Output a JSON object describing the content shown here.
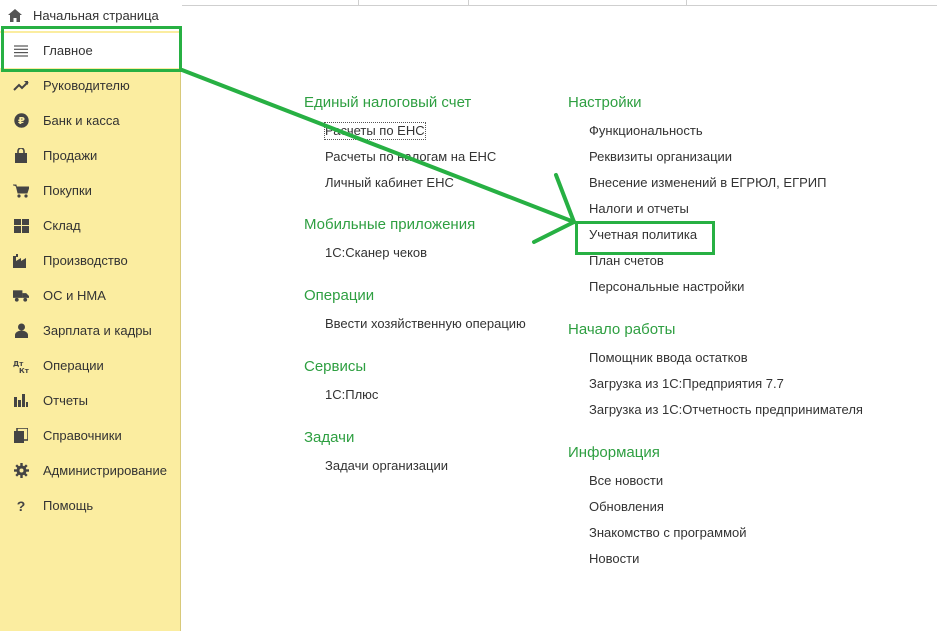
{
  "sidebar": {
    "home_label": "Начальная страница",
    "items": [
      {
        "label": "Главное",
        "icon": "menu-lines-icon",
        "active": true
      },
      {
        "label": "Руководителю",
        "icon": "trend-up-icon"
      },
      {
        "label": "Банк и касса",
        "icon": "ruble-coin-icon"
      },
      {
        "label": "Продажи",
        "icon": "shopping-bag-icon"
      },
      {
        "label": "Покупки",
        "icon": "shopping-cart-icon"
      },
      {
        "label": "Склад",
        "icon": "warehouse-grid-icon"
      },
      {
        "label": "Производство",
        "icon": "factory-icon"
      },
      {
        "label": "ОС и НМА",
        "icon": "truck-icon"
      },
      {
        "label": "Зарплата и кадры",
        "icon": "person-icon"
      },
      {
        "label": "Операции",
        "icon": "debit-credit-icon"
      },
      {
        "label": "Отчеты",
        "icon": "bar-chart-icon"
      },
      {
        "label": "Справочники",
        "icon": "books-icon"
      },
      {
        "label": "Администрирование",
        "icon": "gear-icon"
      },
      {
        "label": "Помощь",
        "icon": "question-icon"
      }
    ]
  },
  "left_sections": [
    {
      "title": "Единый налоговый счет",
      "links": [
        "Расчеты по ЕНС",
        "Расчеты по налогам на ЕНС",
        "Личный кабинет ЕНС"
      ]
    },
    {
      "title": "Мобильные приложения",
      "links": [
        "1С:Сканер чеков"
      ]
    },
    {
      "title": "Операции",
      "links": [
        "Ввести хозяйственную операцию"
      ]
    },
    {
      "title": "Сервисы",
      "links": [
        "1С:Плюс"
      ]
    },
    {
      "title": "Задачи",
      "links": [
        "Задачи организации"
      ]
    }
  ],
  "right_sections": [
    {
      "title": "Настройки",
      "links": [
        "Функциональность",
        "Реквизиты организации",
        "Внесение изменений в ЕГРЮЛ, ЕГРИП",
        "Налоги и отчеты",
        "Учетная политика",
        "План счетов",
        "Персональные настройки"
      ]
    },
    {
      "title": "Начало работы",
      "links": [
        "Помощник ввода остатков",
        "Загрузка из 1С:Предприятия 7.7",
        "Загрузка из 1С:Отчетность предпринимателя"
      ]
    },
    {
      "title": "Информация",
      "links": [
        "Все новости",
        "Обновления",
        "Знакомство с программой",
        "Новости"
      ]
    }
  ],
  "colors": {
    "accent_green": "#2e9f41",
    "highlight_green": "#27b043",
    "sidebar_bg": "#fbeda0"
  }
}
